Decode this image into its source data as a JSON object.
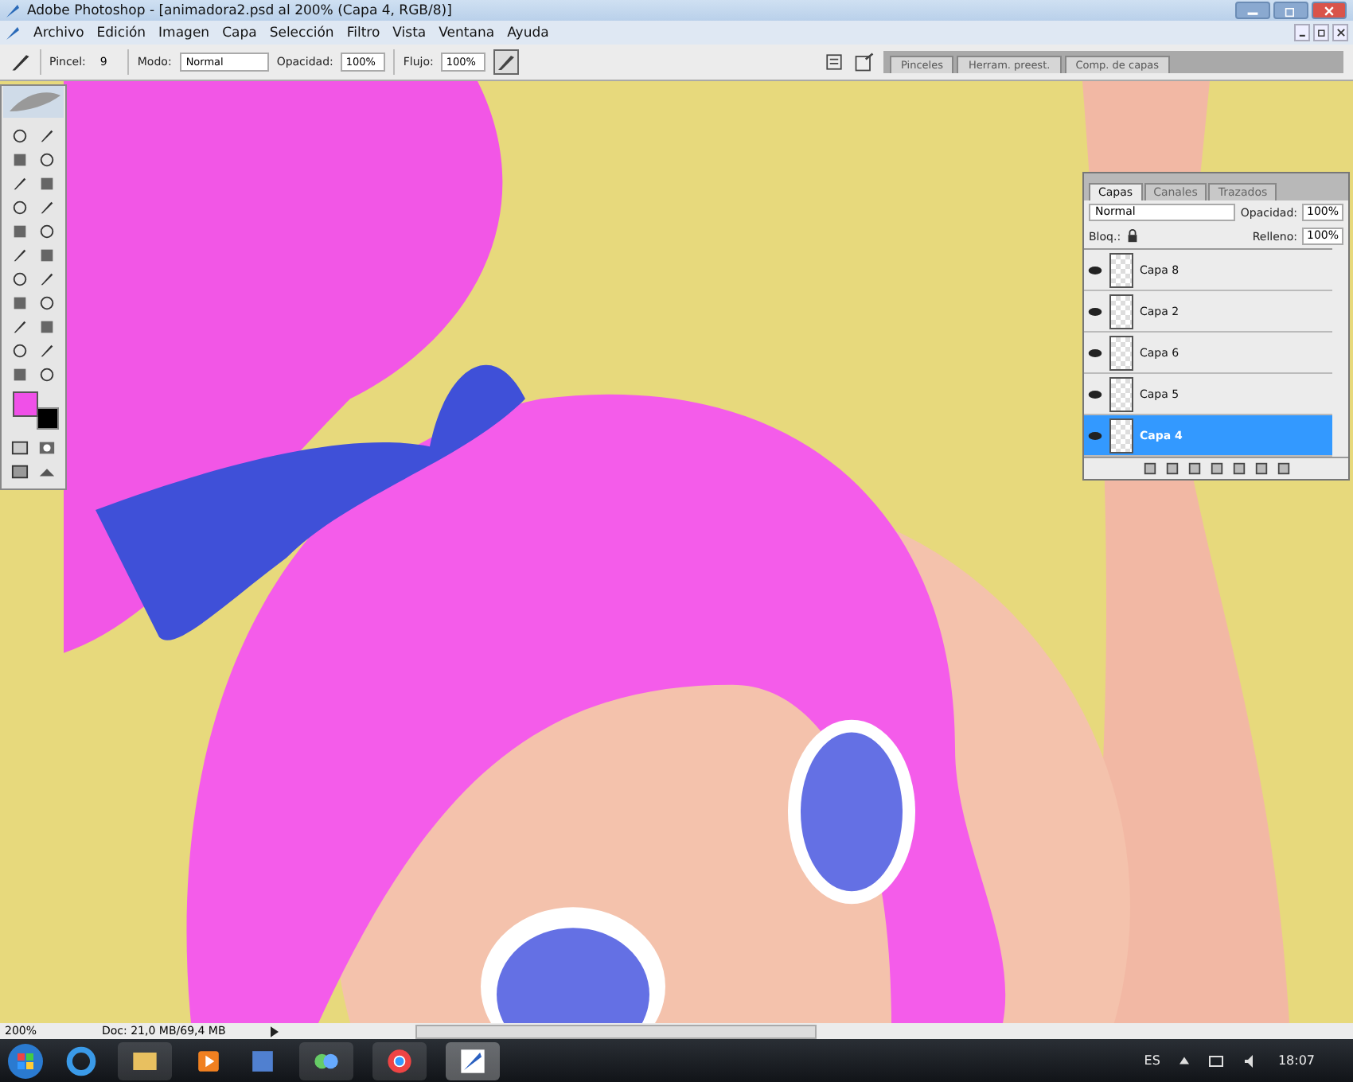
{
  "window": {
    "title": "Adobe Photoshop - [animadora2.psd al 200% (Capa 4, RGB/8)]"
  },
  "menu": [
    "Archivo",
    "Edición",
    "Imagen",
    "Capa",
    "Selección",
    "Filtro",
    "Vista",
    "Ventana",
    "Ayuda"
  ],
  "options_bar": {
    "brush_label": "Pincel:",
    "brush_size": "9",
    "mode_label": "Modo:",
    "mode": "Normal",
    "opacity_label": "Opacidad:",
    "opacity": "100%",
    "flow_label": "Flujo:",
    "flow": "100%"
  },
  "palette_well": [
    "Pinceles",
    "Herram. preest.",
    "Comp. de capas"
  ],
  "layers_panel": {
    "tabs": [
      {
        "label": "Capas",
        "selected": true
      },
      {
        "label": "Canales",
        "selected": false
      },
      {
        "label": "Trazados",
        "selected": false
      }
    ],
    "blend_mode": "Normal",
    "opacity_label": "Opacidad:",
    "opacity": "100%",
    "lock_label": "Bloq.:",
    "fill_label": "Relleno:",
    "fill": "100%",
    "layers": [
      {
        "name": "Capa 8",
        "visible": true,
        "selected": false
      },
      {
        "name": "Capa 2",
        "visible": true,
        "selected": false
      },
      {
        "name": "Capa 6",
        "visible": true,
        "selected": false
      },
      {
        "name": "Capa 5",
        "visible": true,
        "selected": false
      },
      {
        "name": "Capa 4",
        "visible": true,
        "selected": true
      }
    ]
  },
  "status_bar": {
    "zoom": "200%",
    "doc": "Doc: 21,0 MB/69,4 MB"
  },
  "taskbar": {
    "language": "ES",
    "time": "18:07"
  }
}
